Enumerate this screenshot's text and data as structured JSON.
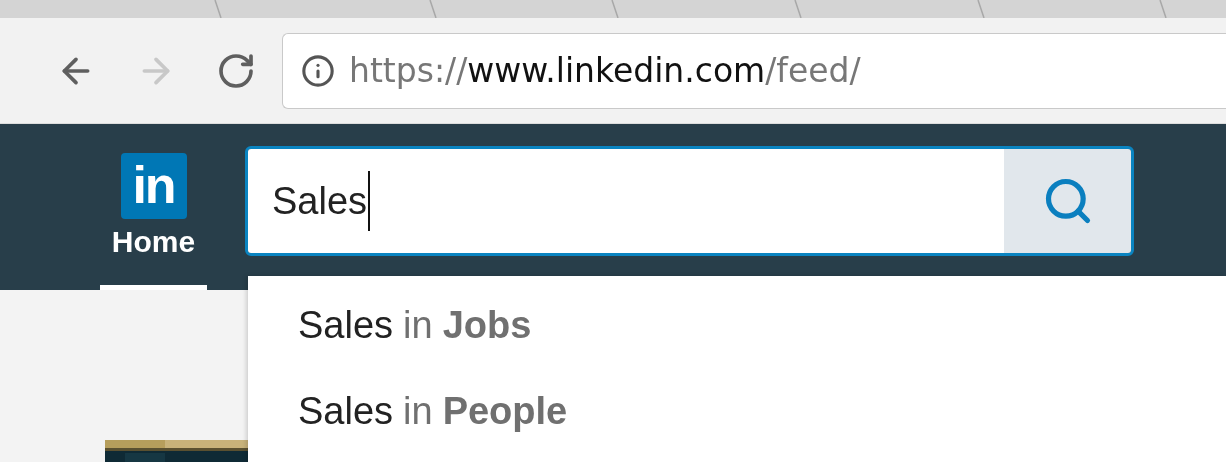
{
  "browser": {
    "nav_buttons": [
      {
        "kind": "back",
        "disabled": false
      },
      {
        "kind": "forward",
        "disabled": true
      },
      {
        "kind": "reload",
        "disabled": false
      }
    ],
    "url": {
      "scheme": "https://",
      "host": "www.linkedin.com",
      "path": "/feed/"
    }
  },
  "nav": {
    "logo": "in",
    "items": [
      {
        "label": "Home",
        "selected": true
      }
    ]
  },
  "search": {
    "value": "Sales"
  },
  "suggestions": [
    {
      "query": "Sales",
      "connector": "in",
      "category": "Jobs"
    },
    {
      "query": "Sales",
      "connector": "in",
      "category": "People"
    }
  ]
}
